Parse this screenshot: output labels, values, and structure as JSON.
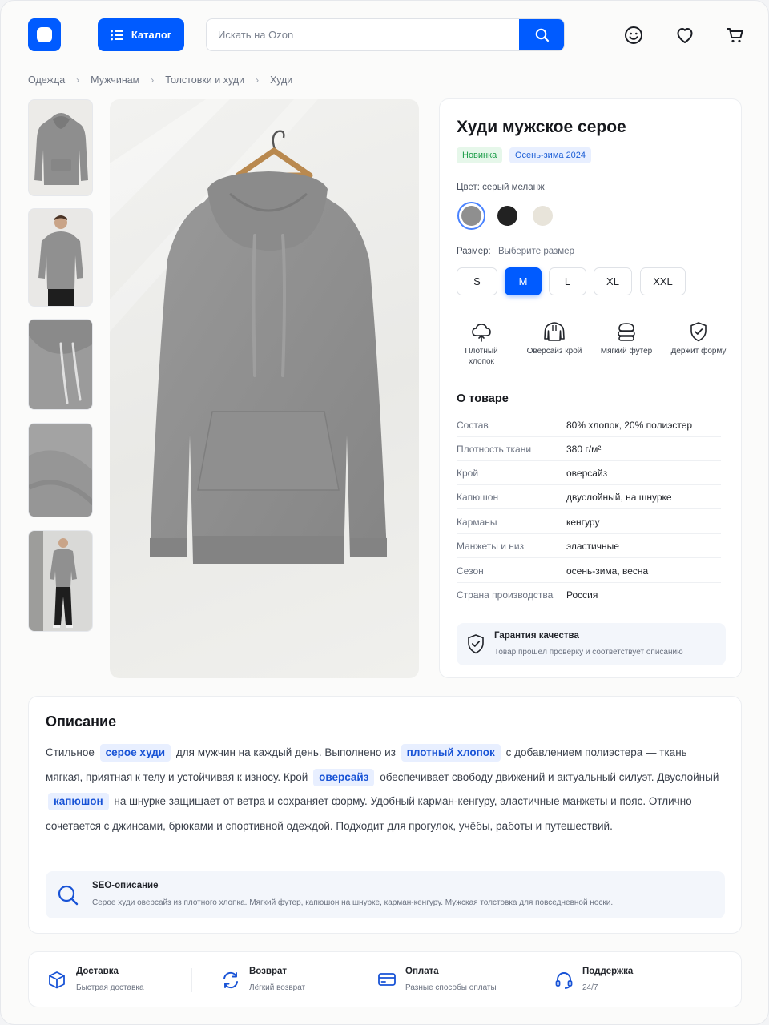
{
  "header": {
    "catalog_label": "Каталог",
    "search_placeholder": "Искать на Ozon"
  },
  "breadcrumb": [
    "Одежда",
    "Мужчинам",
    "Толстовки и худи",
    "Худи"
  ],
  "product": {
    "title": "Худи мужское серое",
    "tags": [
      "Новинка",
      "Осень-зима 2024"
    ],
    "color_label": "Цвет: серый меланж",
    "colors": [
      {
        "name": "серый меланж",
        "hex": "#8f8f8f",
        "selected": true
      },
      {
        "name": "чёрный",
        "hex": "#222222",
        "selected": false
      },
      {
        "name": "бежевый",
        "hex": "#e8e4da",
        "selected": false
      }
    ],
    "size_label": "Размер:",
    "size_hint": "Выберите размер",
    "sizes": [
      "S",
      "M",
      "L",
      "XL",
      "XXL"
    ],
    "selected_size": "M",
    "features": [
      {
        "icon": "cloud-cotton-icon",
        "label": "Плотный хлопок"
      },
      {
        "icon": "hoodie-icon",
        "label": "Оверсайз крой"
      },
      {
        "icon": "soft-fabric-icon",
        "label": "Мягкий футер"
      },
      {
        "icon": "shield-check-icon",
        "label": "Держит форму"
      }
    ],
    "about_title": "О товаре",
    "specs": [
      {
        "key": "Состав",
        "value": "80% хлопок, 20% полиэстер"
      },
      {
        "key": "Плотность ткани",
        "value": "380 г/м²"
      },
      {
        "key": "Крой",
        "value": "оверсайз"
      },
      {
        "key": "Капюшон",
        "value": "двуслойный, на шнурке"
      },
      {
        "key": "Карманы",
        "value": "кенгуру"
      },
      {
        "key": "Манжеты и низ",
        "value": "эластичные"
      },
      {
        "key": "Сезон",
        "value": "осень-зима, весна"
      },
      {
        "key": "Страна производства",
        "value": "Россия"
      }
    ],
    "guarantee_title": "Гарантия качества",
    "guarantee_text": "Товар прошёл проверку и соответствует описанию"
  },
  "description": {
    "title": "Описание",
    "parts": [
      "Стильное",
      "серое худи",
      "для мужчин на каждый день. Выполнено из",
      "плотный хлопок",
      "с добавлением полиэстера — ткань мягкая, приятная к телу и устойчивая к износу.  Крой",
      "оверсайз",
      "обеспечивает свободу движений и актуальный силуэт. Двуслойный",
      "капюшон",
      "на шнурке защищает от ветра и сохраняет форму. Удобный карман-кенгуру, эластичные манжеты и пояс. Отлично сочетается с джинсами, брюками и спортивной одеждой. Подходит для прогулок, учёбы, работы и путешествий."
    ],
    "seo_title": "SEO-описание",
    "seo_text": "Серое худи оверсайз из плотного хлопка. Мягкий футер, капюшон на шнурке, карман-кенгуру. Мужская толстовка для повседневной носки."
  },
  "benefits": [
    {
      "icon": "box-icon",
      "title": "Доставка",
      "subtitle": "Быстрая доставка"
    },
    {
      "icon": "return-icon",
      "title": "Возврат",
      "subtitle": "Лёгкий возврат"
    },
    {
      "icon": "card-icon",
      "title": "Оплата",
      "subtitle": "Разные способы оплаты"
    },
    {
      "icon": "headset-icon",
      "title": "Поддержка",
      "subtitle": "24/7"
    }
  ],
  "colors": {
    "accent": "#005bff",
    "highlight_bg": "#e8efff",
    "tag_green": "#1a9c47"
  }
}
